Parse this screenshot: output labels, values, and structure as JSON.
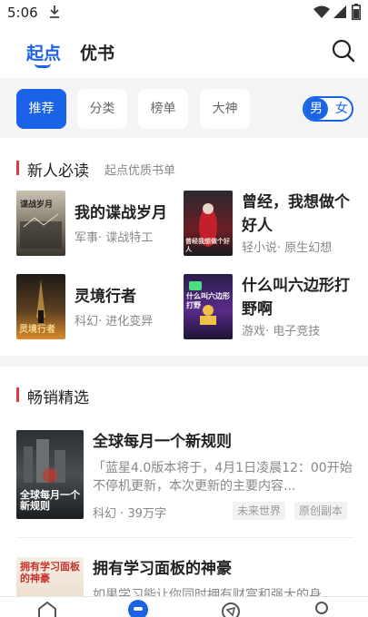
{
  "status": {
    "time": "5:06"
  },
  "header": {
    "tabs": [
      {
        "label": "起点"
      },
      {
        "label": "优书"
      }
    ]
  },
  "categories": {
    "items": [
      {
        "label": "推荐"
      },
      {
        "label": "分类"
      },
      {
        "label": "榜单"
      },
      {
        "label": "大神"
      }
    ],
    "gender": {
      "male": "男",
      "female": "女"
    }
  },
  "new_reader": {
    "title": "新人必读",
    "subtitle": "起点优质书单",
    "books": [
      {
        "title": "我的谍战岁月",
        "meta": "军事· 谍战特工",
        "cover_text": "谍战岁月"
      },
      {
        "title": "曾经，我想做个好人",
        "meta": "轻小说· 原生幻想",
        "cover_text": "曾经我想做个好人"
      },
      {
        "title": "灵境行者",
        "meta": "科幻· 进化变异",
        "cover_text": "灵境行者"
      },
      {
        "title": "什么叫六边形打野啊",
        "meta": "游戏· 电子竞技",
        "cover_text": "什么叫六边形打野"
      }
    ]
  },
  "bestseller": {
    "title": "畅销精选",
    "books": [
      {
        "title": "全球每月一个新规则",
        "desc": "「蓝星4.0版本将于，4月1日凌晨12：00开始不停机更新，本次更新的主要内容...",
        "meta": "科幻 · 39万字",
        "tags": [
          "未来世界",
          "原创副本"
        ],
        "cover_text": "全球每月一个新规则"
      },
      {
        "title": "拥有学习面板的神豪",
        "desc": "如果学习能让你同时拥有财富和强大的身",
        "cover_text": "拥有学习面板的神豪"
      }
    ]
  }
}
